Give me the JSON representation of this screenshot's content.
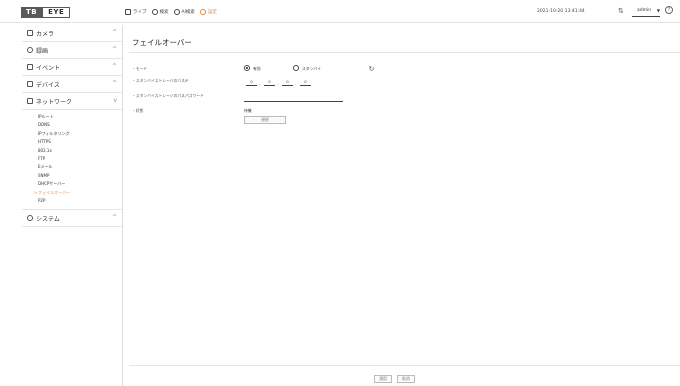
{
  "app": {
    "logo_left": "TB",
    "logo_right": "EYE",
    "datetime": "2021-10-20 13:41:44",
    "user": "admin"
  },
  "topnav": [
    {
      "label": "ライブ",
      "icon": "monitor-icon"
    },
    {
      "label": "検索",
      "icon": "search-icon"
    },
    {
      "label": "AI検索",
      "icon": "ai-search-icon"
    },
    {
      "label": "設定",
      "icon": "gear-icon"
    }
  ],
  "sidebar": {
    "sections": [
      {
        "label": "カメラ",
        "icon": "camera-icon"
      },
      {
        "label": "録画",
        "icon": "record-icon"
      },
      {
        "label": "イベント",
        "icon": "event-icon"
      },
      {
        "label": "デバイス",
        "icon": "device-icon"
      },
      {
        "label": "ネットワーク",
        "icon": "network-icon"
      },
      {
        "label": "システム",
        "icon": "system-icon"
      }
    ],
    "network_items": [
      "IPルート",
      "DDNS",
      "IPフィルタリング",
      "HTTPS",
      "802.1x",
      "FTP",
      "Eメール",
      "SNMP",
      "DHCPサーバー",
      "フェイルオーバー",
      "P2P"
    ],
    "active_item": "フェイルオーバー"
  },
  "main": {
    "title": "フェイルオーバー",
    "mode_label": "・モード",
    "mode_options": [
      "有効",
      "スタンバイ"
    ],
    "mode_selected": "有効",
    "ip_label": "・スタンバイストレージのパスIP",
    "ip_values": [
      "0",
      "0",
      "0",
      "0"
    ],
    "password_label": "・スタンバイストレージのパスパスワード",
    "status_label": "・状態",
    "status_value": "待機",
    "status_button": "接続",
    "apply_button": "適用",
    "cancel_button": "取消"
  },
  "colors": {
    "accent": "#e48a3c"
  }
}
